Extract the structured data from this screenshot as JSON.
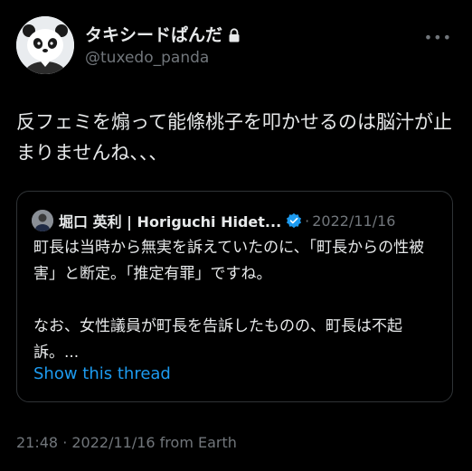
{
  "author": {
    "display_name": "タキシードぱんだ",
    "handle": "@tuxedo_panda",
    "protected_icon": "lock-icon",
    "avatar": "panda-avatar"
  },
  "more_icon": "more-horizontal-icon",
  "more_glyph": "•••",
  "tweet": {
    "text": "反フェミを煽って能條桃子を叩かせるのは脳汁が止まりませんね、、、"
  },
  "quote": {
    "author_name": "堀口 英利 | Horiguchi Hidet...",
    "verified_icon": "verified-badge-icon",
    "separator": "·",
    "date": "2022/11/16",
    "paragraph1": "町長は当時から無実を訴えていたのに、「町長からの性被害」と断定。「推定有罪」ですね。",
    "paragraph2": "なお、女性議員が町長を告訴したものの、町長は不起訴。...",
    "show_thread": "Show this thread"
  },
  "timestamp": "21:48 · 2022/11/16 from Earth",
  "colors": {
    "background": "#000000",
    "text": "#e7e9ea",
    "muted": "#71767b",
    "accent": "#1d9bf0",
    "border": "#2f3336"
  }
}
